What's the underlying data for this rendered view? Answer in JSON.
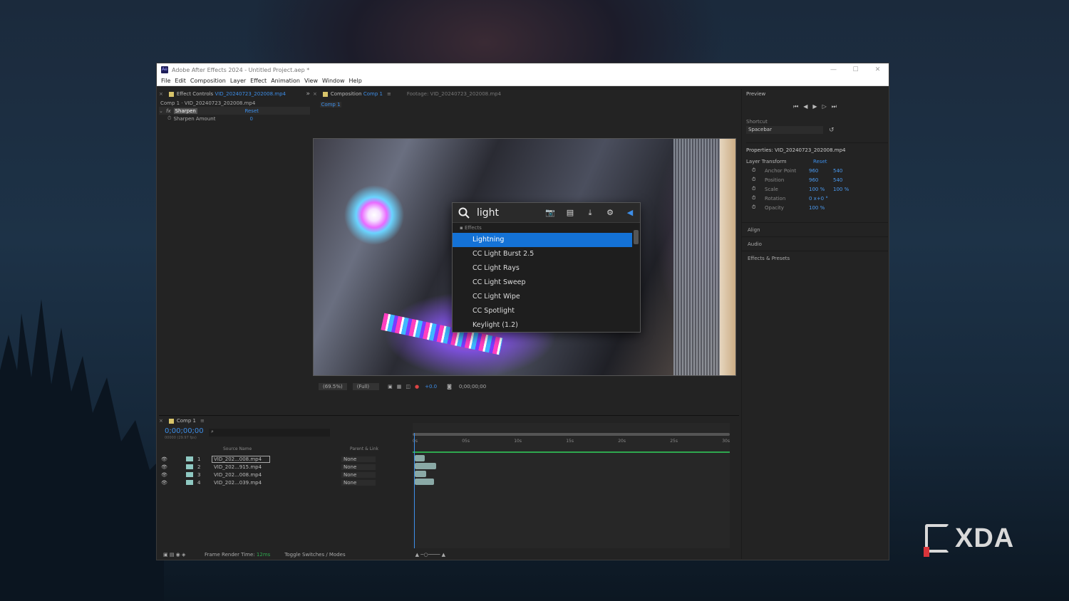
{
  "window": {
    "title": "Adobe After Effects 2024 - Untitled Project.aep *",
    "app_badge": "Ae",
    "controls": [
      "—",
      "☐",
      "✕"
    ]
  },
  "menu": [
    "File",
    "Edit",
    "Composition",
    "Layer",
    "Effect",
    "Animation",
    "View",
    "Window",
    "Help"
  ],
  "effect_controls": {
    "tab_label": "Effect Controls",
    "tab_file": "VID_20240723_202008.mp4",
    "breadcrumb": "Comp 1 · VID_20240723_202008.mp4",
    "effect_name": "Sharpen",
    "reset": "Reset",
    "param_name": "Sharpen Amount",
    "param_value": "0"
  },
  "composition": {
    "tab_label": "Composition",
    "tab_name": "Comp 1",
    "footage_tab": "Footage: VID_20240723_202008.mp4",
    "subtab": "Comp 1",
    "zoom": "(69.5%)",
    "resolution": "(Full)",
    "exposure": "+0.0",
    "timecode": "0;00;00;00"
  },
  "search": {
    "query": "light",
    "category": "Effects",
    "results": [
      "Lightning",
      "CC Light Burst 2.5",
      "CC Light Rays",
      "CC Light Sweep",
      "CC Light Wipe",
      "CC Spotlight",
      "Keylight (1.2)"
    ]
  },
  "preview": {
    "title": "Preview",
    "shortcut_label": "Shortcut",
    "shortcut_value": "Spacebar",
    "properties_title": "Properties: VID_20240723_202008.mp4",
    "layer_transform": "Layer Transform",
    "reset": "Reset",
    "props": [
      {
        "name": "Anchor Point",
        "v1": "960",
        "v2": "540"
      },
      {
        "name": "Position",
        "v1": "960",
        "v2": "540"
      },
      {
        "name": "Scale",
        "v1": "100 %",
        "v2": "100 %"
      },
      {
        "name": "Rotation",
        "v1": "0 x+0 °",
        "v2": ""
      },
      {
        "name": "Opacity",
        "v1": "100 %",
        "v2": ""
      }
    ],
    "sections": [
      "Align",
      "Audio",
      "Effects & Presets"
    ]
  },
  "timeline": {
    "tab": "Comp 1",
    "timecode": "0;00;00;00",
    "fps": "00000 (29.97 fps)",
    "col_source": "Source Name",
    "col_parent": "Parent & Link",
    "ruler": [
      "0s",
      "05s",
      "10s",
      "15s",
      "20s",
      "25s",
      "30s"
    ],
    "layers": [
      {
        "num": "1",
        "name": "VID_202...008.mp4",
        "parent": "None"
      },
      {
        "num": "2",
        "name": "VID_202...915.mp4",
        "parent": "None"
      },
      {
        "num": "3",
        "name": "VID_202...008.mp4",
        "parent": "None"
      },
      {
        "num": "4",
        "name": "VID_202...039.mp4",
        "parent": "None"
      }
    ],
    "frame_render_label": "Frame Render Time:",
    "frame_render_value": "12ms",
    "toggle": "Toggle Switches / Modes"
  },
  "watermark": "XDA",
  "colors": {
    "accent": "#1472d6",
    "link_blue": "#3d8ee8",
    "green": "#2fa84f"
  }
}
